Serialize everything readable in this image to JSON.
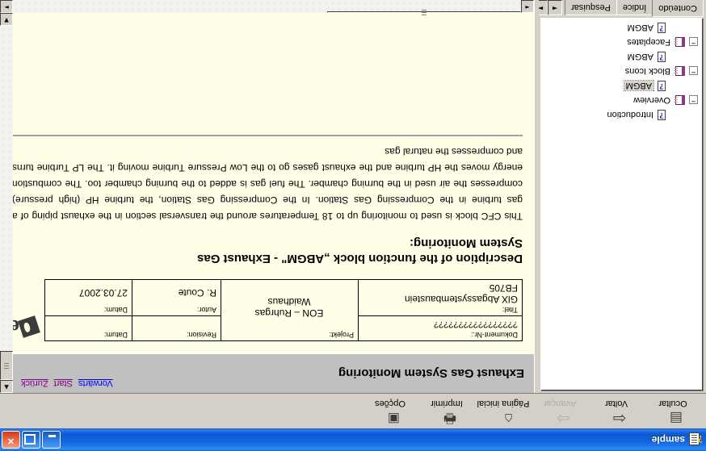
{
  "window": {
    "title": "sample",
    "icon": "help-document-icon",
    "buttons": {
      "minimize": "Minimizar",
      "maximize": "Maximizar",
      "close": "Fechar"
    }
  },
  "toolbar": {
    "items": [
      {
        "label": "Ocultar",
        "icon": "hide-pane-icon",
        "disabled": false
      },
      {
        "label": "Voltar",
        "icon": "back-arrow-icon",
        "disabled": false
      },
      {
        "label": "Avançar",
        "icon": "forward-arrow-icon",
        "disabled": true
      },
      {
        "label": "Página inicial",
        "icon": "home-icon",
        "disabled": false
      },
      {
        "label": "Imprimir",
        "icon": "printer-icon",
        "disabled": false
      },
      {
        "label": "Opções",
        "icon": "options-icon",
        "disabled": false
      }
    ]
  },
  "nav_pane": {
    "tabs": [
      {
        "label": "Conteúdo",
        "active": true
      },
      {
        "label": "Índice",
        "active": false
      },
      {
        "label": "Pesquisar",
        "active": false
      }
    ],
    "spinner": {
      "left": "◄",
      "right": "►"
    },
    "tree": [
      {
        "level": 2,
        "type": "page",
        "label": "Introduction",
        "expander": "",
        "selected": false
      },
      {
        "level": 1,
        "type": "book",
        "label": "Overview",
        "expander": "−",
        "selected": false
      },
      {
        "level": 2,
        "type": "page",
        "label": "ABGM",
        "expander": "",
        "selected": true
      },
      {
        "level": 1,
        "type": "book",
        "label": "Block Icons",
        "expander": "−",
        "selected": false
      },
      {
        "level": 2,
        "type": "page",
        "label": "ABGM",
        "expander": "",
        "selected": false
      },
      {
        "level": 1,
        "type": "book",
        "label": "Faceplates",
        "expander": "−",
        "selected": false
      },
      {
        "level": 2,
        "type": "page",
        "label": "ABGM",
        "expander": "",
        "selected": false
      }
    ]
  },
  "page": {
    "header_title": "Exhaust Gas System Monitoring",
    "nav_links": [
      {
        "label": "Vorwärts",
        "kind": "forward"
      },
      {
        "label": "Start",
        "kind": "home"
      },
      {
        "label": "Zurück",
        "kind": "back"
      }
    ],
    "doc_table": {
      "title_key": "Titel:",
      "title_line1": "GlX Abgassystembaustein",
      "title_line2": "FB705",
      "document_nr_key": "Dokument-Nr.:",
      "document_nr_value": "?????????????????",
      "project_key": "Projekt:",
      "project_line1": "EON – Ruhrgas",
      "project_line2": "Waidhaus",
      "revision_key": "Revision:",
      "revision_value": "",
      "revision_date_key": "Datum:",
      "revision_date_value": "",
      "author_key": "Autor:",
      "author_value": "R. Coute",
      "date_key": "Datum:",
      "date_value": "27.03.2007",
      "logo_text": "evonik"
    },
    "heading_line1": "Description of the function block „ABGM\" - Exhaust Gas",
    "heading_line2": "System Monitoring:",
    "paragraph": "This CFC block is used to monitoring up to 18 Temperatures around the transversal section in the exhaust piping of a gas turbine in the Compressing Gas Station. In the Compressing Gas Station, the turbine HP (high pressure) compresses the air used in the burning chamber. The fuel gas is added to the burning chamber too. The combustion energy moves the HP turbine and the exhaust gases go to the Low Pressure Turbine moving it. The LP Turbine turns and compresses the natural gas"
  },
  "scrollbars": {
    "up": "▲",
    "down": "▼",
    "left": "◄",
    "right": "►"
  },
  "colors": {
    "title_bar": "#1464e0",
    "page_header_band": "#c0c0c0",
    "page_background": "#ffffe8",
    "link_visited": "#800080",
    "link_unvisited": "#0000ee"
  }
}
